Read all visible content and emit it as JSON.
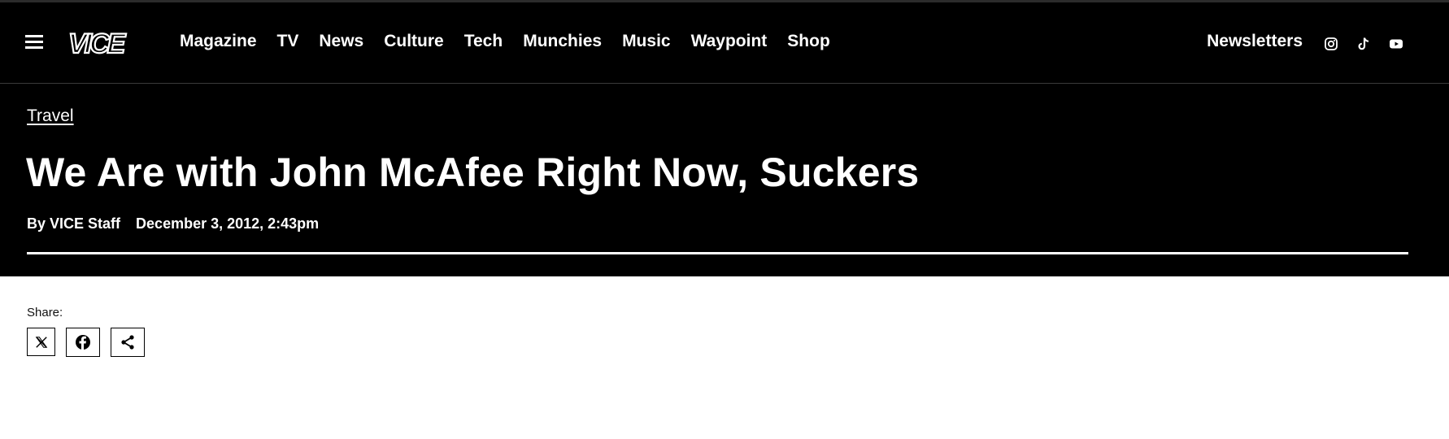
{
  "header": {
    "logo": "VICE",
    "nav": [
      "Magazine",
      "TV",
      "News",
      "Culture",
      "Tech",
      "Munchies",
      "Music",
      "Waypoint",
      "Shop"
    ],
    "newsletters": "Newsletters",
    "social_icons": [
      "instagram-icon",
      "tiktok-icon",
      "youtube-icon"
    ]
  },
  "article": {
    "category": "Travel",
    "title": "We Are with John McAfee Right Now, Suckers",
    "author": "By VICE Staff",
    "date": "December 3, 2012, 2:43pm"
  },
  "share": {
    "label": "Share:",
    "buttons": [
      "x-icon",
      "facebook-icon",
      "share-icon"
    ]
  },
  "colors": {
    "background_dark": "#000000",
    "text_light": "#ffffff",
    "page_background": "#ffffff"
  }
}
